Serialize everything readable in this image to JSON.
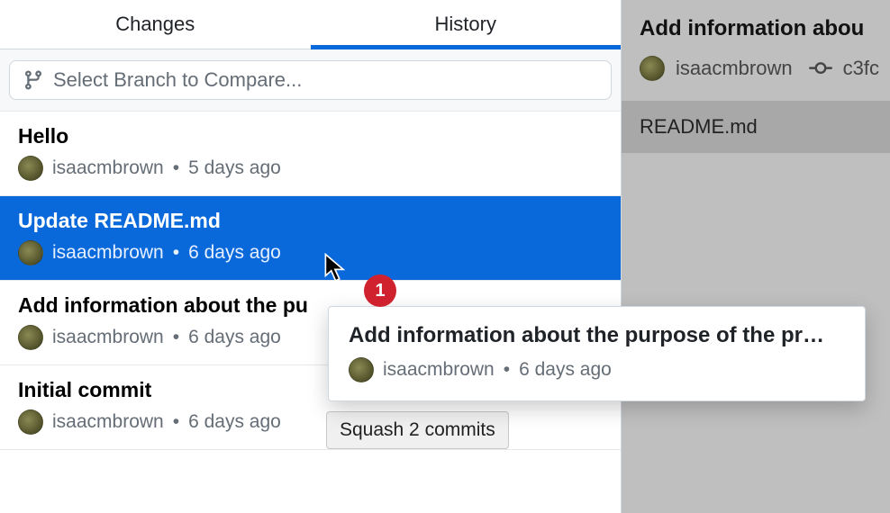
{
  "tabs": {
    "changes": "Changes",
    "history": "History"
  },
  "branchCompare": {
    "placeholder": "Select Branch to Compare..."
  },
  "commits": [
    {
      "title": "Hello",
      "author": "isaacmbrown",
      "time": "5 days ago"
    },
    {
      "title": "Update README.md",
      "author": "isaacmbrown",
      "time": "6 days ago"
    },
    {
      "title": "Add information about the pu",
      "author": "isaacmbrown",
      "time": "6 days ago"
    },
    {
      "title": "Initial commit",
      "author": "isaacmbrown",
      "time": "6 days ago"
    }
  ],
  "rightPanel": {
    "title": "Add information abou",
    "author": "isaacmbrown",
    "shaPrefix": "c3fc",
    "file": "README.md"
  },
  "dragCard": {
    "title": "Add information about the purpose of the pr…",
    "author": "isaacmbrown",
    "time": "6 days ago",
    "badge": "1"
  },
  "tooltip": "Squash 2 commits",
  "dotSep": "•"
}
